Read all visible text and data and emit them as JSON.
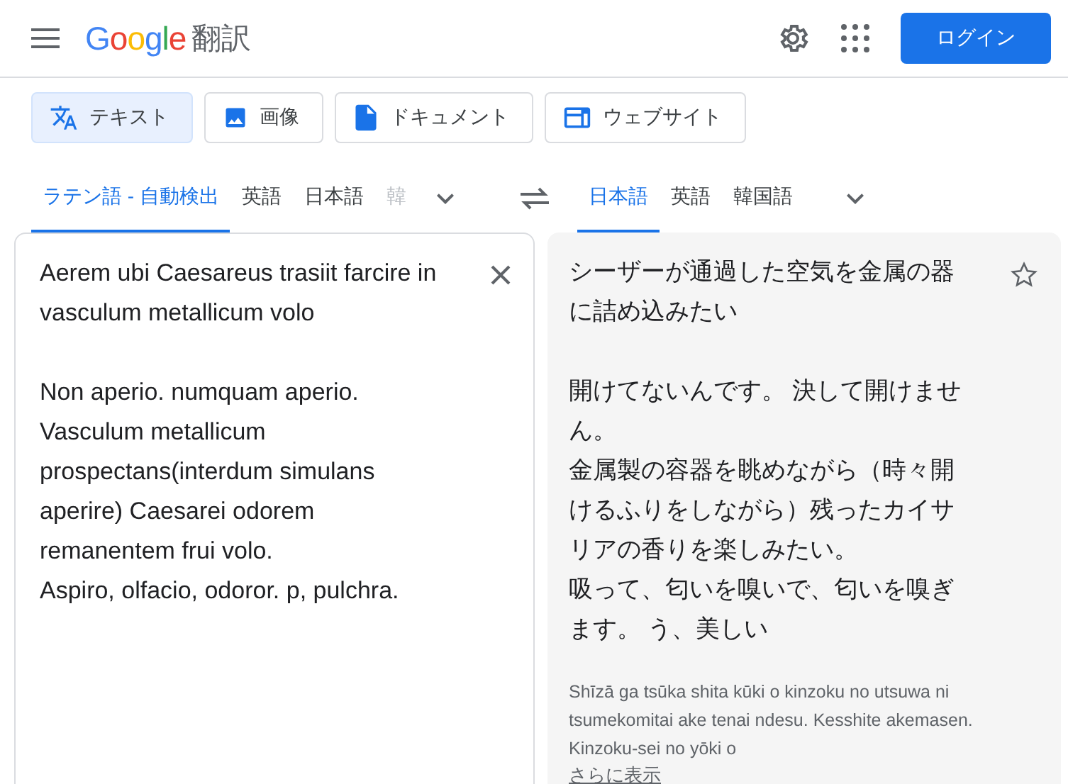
{
  "header": {
    "logo": "Google",
    "product": "翻訳",
    "login": "ログイン"
  },
  "modes": [
    {
      "kind": "text",
      "label": "テキスト",
      "selected": true
    },
    {
      "kind": "image",
      "label": "画像",
      "selected": false
    },
    {
      "kind": "document",
      "label": "ドキュメント",
      "selected": false
    },
    {
      "kind": "website",
      "label": "ウェブサイト",
      "selected": false
    }
  ],
  "source_languages": [
    {
      "label": "ラテン語 - 自動検出",
      "selected": true,
      "faded": false
    },
    {
      "label": "英語",
      "selected": false,
      "faded": false
    },
    {
      "label": "日本語",
      "selected": false,
      "faded": false
    },
    {
      "label": "韓",
      "selected": false,
      "faded": true
    }
  ],
  "target_languages": [
    {
      "label": "日本語",
      "selected": true
    },
    {
      "label": "英語",
      "selected": false
    },
    {
      "label": "韓国語",
      "selected": false
    }
  ],
  "source_text": [
    [
      "Aerem ubi Caesareus trasiit farcire in vasculum metallicum volo"
    ],
    [
      "Non aperio. numquam aperio.",
      "Vasculum metallicum prospectans(interdum simulans aperire) Caesarei odorem remanentem frui volo.",
      "Aspiro, olfacio, odoror. p, pulchra."
    ]
  ],
  "translation": [
    [
      "シーザーが通過した空気を金属の器に詰め込みたい"
    ],
    [
      "開けてないんです。 決して開けません。",
      "金属製の容器を眺めながら（時々開けるふりをしながら）残ったカイサリアの香りを楽しみたい。",
      "吸って、匂いを嗅いで、匂いを嗅ぎます。 う、美しい"
    ]
  ],
  "romanization": "Shīzā ga tsūka shita kūki o kinzoku no utsuwa ni tsumekomitai ake tenai ndesu. Kesshite akemasen. Kinzoku-sei no yōki o",
  "show_more": "さらに表示"
}
